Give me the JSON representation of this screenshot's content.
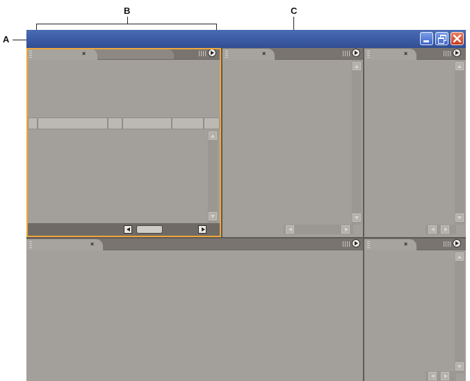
{
  "callouts": {
    "a": "A",
    "b": "B",
    "c": "C"
  },
  "panels": {
    "top_left": {
      "close_glyph": "×"
    },
    "top_middle": {
      "close_glyph": "×"
    },
    "top_right": {
      "close_glyph": "×"
    },
    "bottom_left": {
      "close_glyph": "×"
    },
    "bottom_right": {
      "close_glyph": "×"
    }
  },
  "colors": {
    "titlebar": "#3b5aa3",
    "panel_body": "#a39f9b",
    "highlight": "#f0a83a",
    "close_button": "#c83a1c"
  },
  "icons": [
    "minimize-icon",
    "restore-icon",
    "close-icon",
    "panel-menu-icon",
    "scroll-arrow-icon",
    "tab-grip-icon"
  ]
}
